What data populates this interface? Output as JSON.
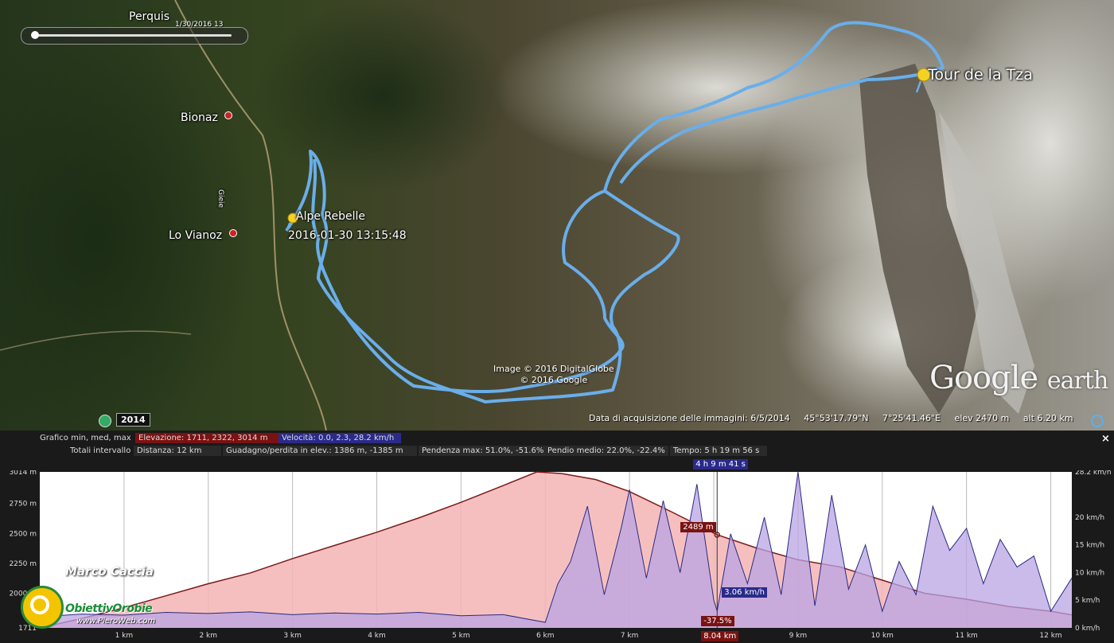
{
  "map": {
    "place_labels": {
      "perquis": "Perquis",
      "bionaz": "Bionaz",
      "lo_vianoz": "Lo Vianoz",
      "alpe_rebelle": "Alpe Rebelle",
      "start_time": "2016-01-30 13:15:48",
      "tour_de_la_tza": "Tour de la Tza",
      "vertical_road_label": "Gieie"
    },
    "time_slider": {
      "date": "1/30/2016  13"
    },
    "historical_imagery_year": "2014",
    "copyright": {
      "line1": "Image © 2016 DigitalGlobe",
      "line2": "© 2016 Google"
    },
    "logo": {
      "google": "Google",
      "earth": "earth"
    },
    "status": {
      "acquisition": "Data di acquisizione delle immagini: 6/5/2014",
      "lat": "45°53'17.79\"N",
      "lon": "7°25'41.46\"E",
      "elev": "elev  2470 m",
      "alt": "alt   6.20 km"
    },
    "colors": {
      "track": "#6aaeea",
      "placemark": "#f4d224"
    }
  },
  "profile": {
    "stats": {
      "grafico": "Grafico  min, med, max",
      "elevazione": "Elevazione: 1711, 2322, 3014 m",
      "velocita": "Velocità: 0.0, 2.3, 28.2 km/h",
      "totali": "Totali intervallo",
      "distanza": "Distanza: 12 km",
      "guadagno": "Guadagno/perdita in elev.: 1386 m, -1385 m",
      "pendenza": "Pendenza max: 51.0%, -51.6%",
      "pendio": "Pendio medio: 22.0%, -22.4%",
      "tempo": "Tempo: 5 h 19 m 56 s"
    },
    "close_label": "×",
    "cursor": {
      "time": "4 h 9 m 41 s",
      "elevation": "2489 m",
      "speed": "3.06 km/h",
      "slope": "-37.5%",
      "distance": "8.04 km"
    },
    "watermark": {
      "author": "Marco Caccia",
      "brand": "ObiettivOrobie",
      "url": "www.PieroWeb.com"
    },
    "colors": {
      "elevation_fill": "#f4b4b4",
      "elevation_line": "#7a1a1a",
      "speed_fill": "#b8a4e4",
      "speed_line": "#2a2a80"
    }
  },
  "chart_data": {
    "type": "area",
    "xlabel": "",
    "x_ticks": [
      "1 km",
      "2 km",
      "3 km",
      "4 km",
      "5 km",
      "6 km",
      "7 km",
      "8 km",
      "9 km",
      "10 km",
      "11 km",
      "12 km"
    ],
    "xlim": [
      0,
      12.25
    ],
    "y_left_ticks": [
      "1711",
      "2000 m",
      "2250 m",
      "2500 m",
      "2750 m",
      "3014 m"
    ],
    "y_left_lim": [
      1711,
      3014
    ],
    "y_right_ticks": [
      "0 km/h",
      "5 km/h",
      "10 km/h",
      "15 km/h",
      "20 km/h",
      "28.2 km/h"
    ],
    "y_right_lim": [
      0,
      28.2
    ],
    "series": [
      {
        "name": "Elevazione",
        "axis": "left",
        "x": [
          0,
          0.5,
          1.0,
          1.5,
          2.0,
          2.5,
          3.0,
          3.5,
          4.0,
          4.5,
          5.0,
          5.5,
          5.9,
          6.2,
          6.6,
          7.0,
          7.5,
          8.04,
          8.5,
          9.0,
          9.5,
          10.0,
          10.5,
          11.0,
          11.5,
          12.0,
          12.25
        ],
        "y": [
          1711,
          1790,
          1880,
          1980,
          2080,
          2170,
          2290,
          2400,
          2510,
          2630,
          2760,
          2900,
          3014,
          3000,
          2950,
          2850,
          2680,
          2489,
          2380,
          2280,
          2220,
          2110,
          2000,
          1950,
          1890,
          1850,
          1820
        ]
      },
      {
        "name": "Velocità",
        "axis": "right",
        "x": [
          0,
          0.5,
          1.0,
          1.5,
          2.0,
          2.5,
          3.0,
          3.5,
          4.0,
          4.5,
          5.0,
          5.5,
          6.0,
          6.15,
          6.3,
          6.5,
          6.7,
          6.9,
          7.0,
          7.2,
          7.4,
          7.6,
          7.8,
          8.0,
          8.04,
          8.2,
          8.4,
          8.6,
          8.8,
          9.0,
          9.2,
          9.4,
          9.6,
          9.8,
          10.0,
          10.2,
          10.4,
          10.6,
          10.8,
          11.0,
          11.2,
          11.4,
          11.6,
          11.8,
          12.0,
          12.25
        ],
        "y": [
          2,
          2.5,
          2.3,
          2.8,
          2.6,
          2.9,
          2.4,
          2.7,
          2.5,
          2.8,
          2.2,
          2.4,
          1.0,
          8,
          12,
          22,
          6,
          18,
          25,
          9,
          23,
          10,
          26,
          5,
          3.06,
          17,
          8,
          20,
          6,
          28.2,
          4,
          24,
          7,
          15,
          3,
          12,
          6,
          22,
          14,
          18,
          8,
          16,
          11,
          13,
          3,
          9
        ]
      }
    ]
  }
}
